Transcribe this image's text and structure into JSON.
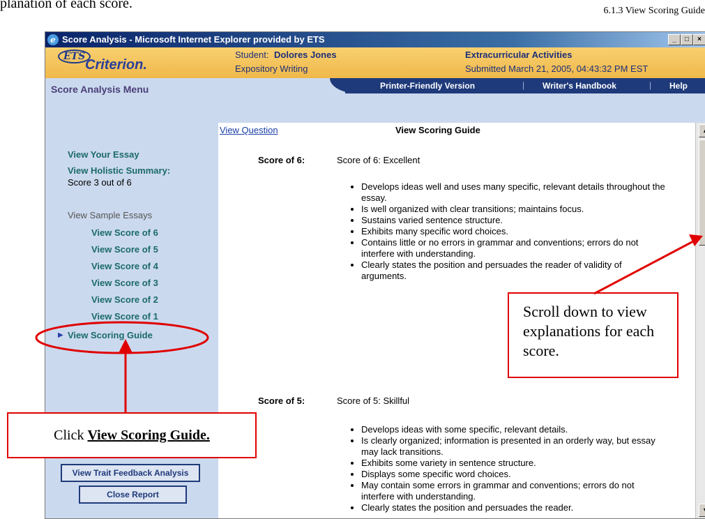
{
  "document": {
    "top_text": "planation of each score.",
    "header_right": "6.1.3 View Scoring Guide"
  },
  "window": {
    "title": "Score Analysis - Microsoft Internet Explorer provided by ETS",
    "controls": {
      "minimize": "_",
      "maximize": "□",
      "close": "×"
    }
  },
  "banner": {
    "logo_ets": "ETS",
    "logo_criterion": "Criterion.",
    "student_label": "Student:",
    "student_name": "Dolores Jones",
    "assignment_type": "Expository Writing",
    "topic": "Extracurricular Activities",
    "submitted": "Submitted March 21, 2005, 04:43:32 PM EST"
  },
  "menu": {
    "title": "Score Analysis Menu",
    "nav": [
      "Printer-Friendly Version",
      "Writer's Handbook",
      "Help"
    ],
    "separator": "|"
  },
  "sidebar": {
    "view_essay": "View Your Essay",
    "view_holistic": "View Holistic Summary:",
    "score_text": "Score 3 out of 6",
    "sample_label": "View Sample Essays",
    "samples": [
      "View Score of 6",
      "View Score of 5",
      "View Score of 4",
      "View Score of 3",
      "View Score of 2",
      "View Score of 1"
    ],
    "scoring_guide": "View Scoring Guide",
    "trait_button": "View Trait Feedback Analysis",
    "close_button": "Close Report"
  },
  "content": {
    "view_question": "View Question",
    "heading": "View Scoring Guide",
    "scores": [
      {
        "label": "Score of 6:",
        "title": "Score of 6:  Excellent",
        "bullets": [
          "Develops ideas well and uses many specific, relevant details throughout the essay.",
          "Is well organized with clear transitions; maintains focus.",
          "Sustains varied sentence structure.",
          "Exhibits many specific word choices.",
          "Contains little or no errors in grammar and conventions; errors do not interfere with understanding.",
          "Clearly states the position and persuades the reader of validity of arguments."
        ]
      },
      {
        "label": "Score of 5:",
        "title": "Score of 5:  Skillful",
        "bullets": [
          "Develops ideas with some specific, relevant details.",
          "Is clearly organized; information is presented in an orderly way, but essay may lack transitions.",
          "Exhibits some variety in sentence structure.",
          "Displays some specific word choices.",
          "May contain some errors in grammar and conventions; errors do not interfere with understanding.",
          "Clearly states the position and persuades the reader."
        ]
      }
    ]
  },
  "callouts": {
    "scroll_note": "Scroll down to view explanations for each score.",
    "click_prefix": "Click ",
    "click_target": "View Scoring Guide."
  },
  "colors": {
    "annotation": "#e00000",
    "nav_bar": "#1e3a7a",
    "sidebar_bg": "#cbd9ee",
    "banner": "#f0b84a",
    "link_teal": "#1a6a6a"
  }
}
